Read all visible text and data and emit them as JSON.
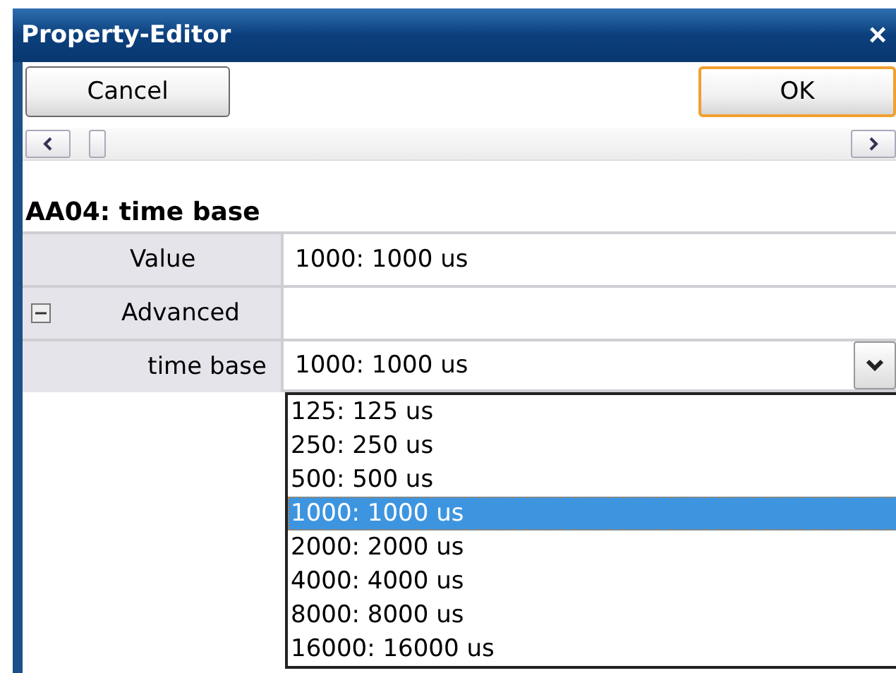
{
  "window": {
    "title": "Property-Editor",
    "close": "×"
  },
  "buttons": [
    {
      "label": "Cancel",
      "default": false
    },
    {
      "label": "OK",
      "default": true
    }
  ],
  "heading": "AA04: time base",
  "properties": [
    {
      "label": "Value",
      "value": "1000: 1000 us",
      "kind": "text"
    },
    {
      "label": "Advanced",
      "kind": "group",
      "expanded": true
    },
    {
      "label": "time base",
      "value": "1000: 1000 us",
      "kind": "dropdown"
    }
  ],
  "dropdown_options": [
    {
      "label": "125: 125 us",
      "selected": false
    },
    {
      "label": "250: 250 us",
      "selected": false
    },
    {
      "label": "500: 500 us",
      "selected": false
    },
    {
      "label": "1000: 1000 us",
      "selected": true
    },
    {
      "label": "2000: 2000 us",
      "selected": false
    },
    {
      "label": "4000: 4000 us",
      "selected": false
    },
    {
      "label": "8000: 8000 us",
      "selected": false
    },
    {
      "label": "16000: 16000 us",
      "selected": false
    }
  ]
}
